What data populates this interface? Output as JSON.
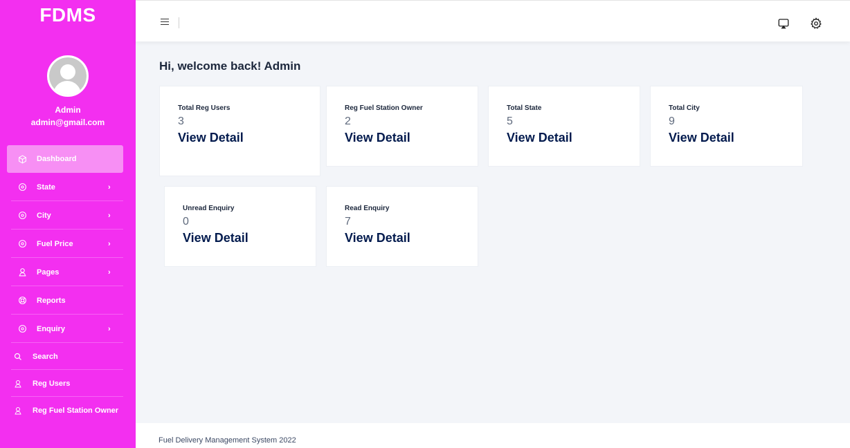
{
  "sidebar": {
    "brand": "FDMS",
    "user_name": "Admin",
    "user_email": "admin@gmail.com",
    "bg_color": "#f32ff0",
    "items": [
      {
        "label": "Dashboard",
        "icon": "cube-icon",
        "active": true
      },
      {
        "label": "State",
        "icon": "target-icon",
        "has_submenu": true
      },
      {
        "label": "City",
        "icon": "target-icon",
        "has_submenu": true
      },
      {
        "label": "Fuel Price",
        "icon": "target-icon",
        "has_submenu": true
      },
      {
        "label": "Pages",
        "icon": "user-icon",
        "has_submenu": true
      },
      {
        "label": "Reports",
        "icon": "lifebuoy-icon"
      },
      {
        "label": "Enquiry",
        "icon": "target-icon",
        "has_submenu": true
      },
      {
        "label": "Search",
        "icon": "search-icon"
      },
      {
        "label": "Reg Users",
        "icon": "user-icon"
      },
      {
        "label": "Reg Fuel Station Owner",
        "icon": "user-icon"
      }
    ]
  },
  "header": {
    "menu_icon": "hamburger-icon",
    "right_icons": [
      "cast-icon",
      "gear-icon"
    ]
  },
  "main": {
    "welcome": "Hi, welcome back! Admin",
    "link_label": "View Detail",
    "cards": [
      {
        "label": "Total Reg Users",
        "value": "3"
      },
      {
        "label": "Reg Fuel Station Owner",
        "value": "2"
      },
      {
        "label": "Total State",
        "value": "5"
      },
      {
        "label": "Total City",
        "value": "9"
      },
      {
        "label": "Unread Enquiry",
        "value": "0"
      },
      {
        "label": "Read Enquiry",
        "value": "7"
      }
    ]
  },
  "footer": {
    "text": "Fuel Delivery Management System 2022"
  }
}
